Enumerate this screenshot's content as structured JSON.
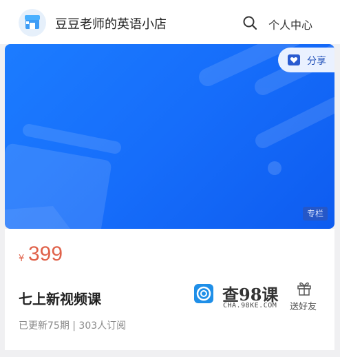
{
  "header": {
    "shop_name": "豆豆老师的英语小店",
    "personal_center": "个人中心",
    "icons": {
      "logo": "shop-icon",
      "search": "search-icon"
    }
  },
  "banner": {
    "share_label": "分享",
    "badge": "专栏",
    "colors": {
      "start": "#1c7cff",
      "end": "#0e5cf0"
    }
  },
  "course": {
    "currency": "¥",
    "price": "399",
    "title": "七上新视频课",
    "meta": "已更新75期 | 303人订阅",
    "gift_label": "送好友"
  },
  "watermark": {
    "main": "查98课",
    "sub": "CHA.98KE.COM"
  },
  "colors": {
    "accent_price": "#e0624a",
    "brand_blue": "#1c7cff"
  }
}
